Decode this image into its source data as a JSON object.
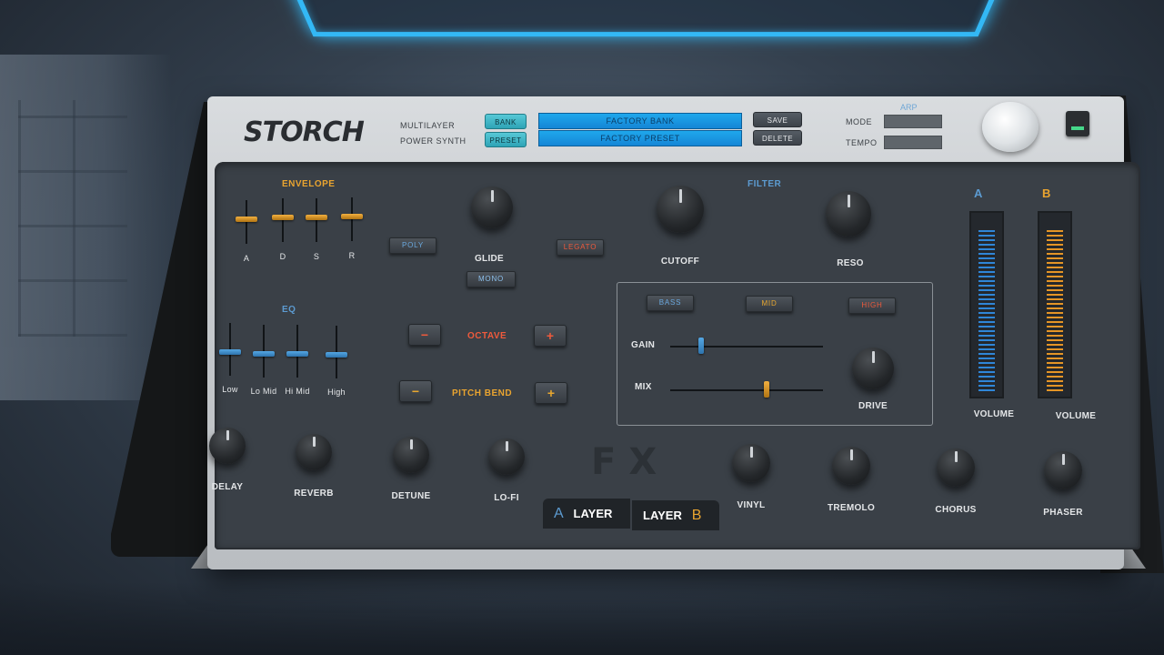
{
  "header": {
    "logo": "STORCH",
    "subtitle_1": "MULTILAYER",
    "subtitle_2": "POWER SYNTH",
    "bank_btn": "BANK",
    "preset_btn": "PRESET",
    "bank_display": "FACTORY BANK",
    "preset_display": "FACTORY PRESET",
    "save_btn": "SAVE",
    "delete_btn": "DELETE",
    "arp_title": "ARP",
    "mode_label": "MODE",
    "tempo_label": "TEMPO"
  },
  "envelope": {
    "title": "ENVELOPE",
    "faders": [
      {
        "label": "A",
        "level": 0.62
      },
      {
        "label": "D",
        "level": 0.62
      },
      {
        "label": "S",
        "level": 0.62
      },
      {
        "label": "R",
        "level": 0.62
      }
    ]
  },
  "eq": {
    "title": "EQ",
    "faders": [
      {
        "label": "Low",
        "level": 0.5
      },
      {
        "label": "Lo Mid",
        "level": 0.5
      },
      {
        "label": "Hi Mid",
        "level": 0.5
      },
      {
        "label": "High",
        "level": 0.5
      }
    ]
  },
  "voice": {
    "poly": "POLY",
    "legato": "LEGATO",
    "mono": "MONO",
    "glide_label": "GLIDE"
  },
  "filter": {
    "title": "FILTER",
    "cutoff_label": "CUTOFF",
    "reso_label": "RESO"
  },
  "octave": {
    "label": "OCTAVE",
    "minus": "−",
    "plus": "+"
  },
  "pitch_bend": {
    "label": "PITCH BEND",
    "minus": "−",
    "plus": "+"
  },
  "band_fx": {
    "bass": "BASS",
    "mid": "MID",
    "high": "HIGH",
    "gain_label": "GAIN",
    "mix_label": "MIX",
    "drive_label": "DRIVE",
    "gain_level": 0.2,
    "mix_level": 0.63
  },
  "volume": {
    "a_title": "A",
    "b_title": "B",
    "a_label": "VOLUME",
    "b_label": "VOLUME",
    "a_level": 0.95,
    "b_level": 0.95
  },
  "fx": {
    "logo": "FX",
    "knobs_left": [
      "DELAY",
      "REVERB",
      "DETUNE",
      "LO-FI"
    ],
    "knobs_right": [
      "VINYL",
      "TREMOLO",
      "CHORUS",
      "PHASER"
    ]
  },
  "layers": {
    "a_letter": "A",
    "a_label": "LAYER",
    "b_label": "LAYER",
    "b_letter": "B"
  },
  "colors": {
    "accent_orange": "#e9a430",
    "accent_blue": "#3b8fd6",
    "lcd_blue": "#1fa7ec",
    "panel": "#3a4047"
  }
}
